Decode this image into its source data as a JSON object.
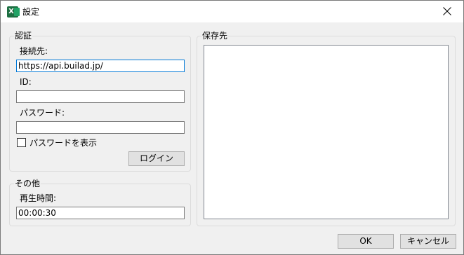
{
  "window": {
    "title": "設定",
    "icon": "excel-icon"
  },
  "auth": {
    "legend": "認証",
    "endpoint_label": "接続先:",
    "endpoint_value": "https://api.builad.jp/",
    "id_label": "ID:",
    "id_value": "",
    "password_label": "パスワード:",
    "password_value": "",
    "show_password_label": "パスワードを表示",
    "show_password_checked": false,
    "login_button": "ログイン"
  },
  "other": {
    "legend": "その他",
    "playback_label": "再生時間:",
    "playback_value": "00:00:30"
  },
  "save": {
    "legend": "保存先"
  },
  "footer": {
    "ok_button": "OK",
    "cancel_button": "キャンセル"
  },
  "colors": {
    "focus_border": "#0078d7",
    "excel_green": "#1d6f42"
  }
}
